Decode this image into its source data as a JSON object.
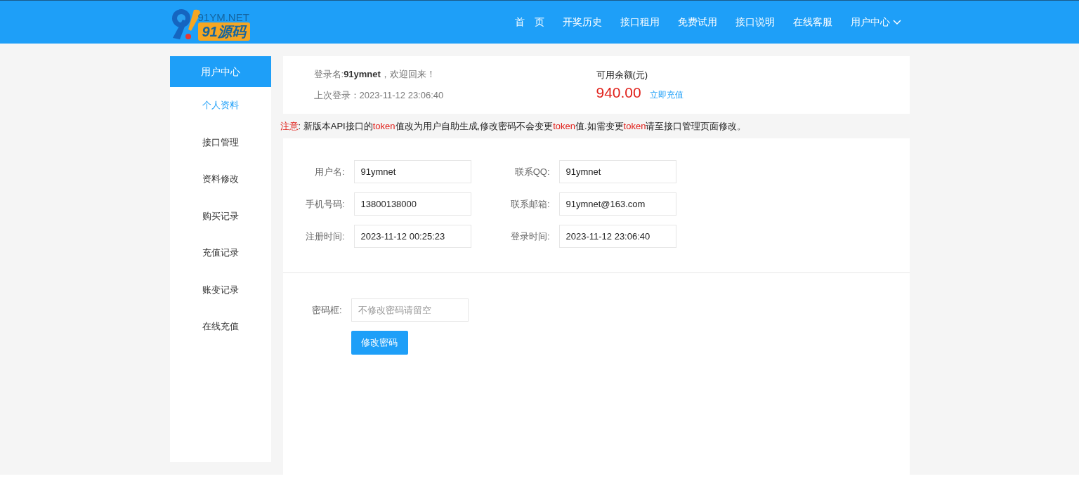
{
  "logo": {
    "domain": "91YM.NET",
    "name": "91源码"
  },
  "nav": [
    {
      "label": "首　页",
      "dropdown": false
    },
    {
      "label": "开奖历史",
      "dropdown": false
    },
    {
      "label": "接口租用",
      "dropdown": false
    },
    {
      "label": "免费试用",
      "dropdown": false
    },
    {
      "label": "接口说明",
      "dropdown": false
    },
    {
      "label": "在线客服",
      "dropdown": false
    },
    {
      "label": "用户中心",
      "dropdown": true
    }
  ],
  "sidebar": {
    "title": "用户中心",
    "items": [
      {
        "label": "个人资料",
        "selected": true
      },
      {
        "label": "接口管理",
        "selected": false
      },
      {
        "label": "资料修改",
        "selected": false
      },
      {
        "label": "购买记录",
        "selected": false
      },
      {
        "label": "充值记录",
        "selected": false
      },
      {
        "label": "账变记录",
        "selected": false
      },
      {
        "label": "在线充值",
        "selected": false
      }
    ]
  },
  "account": {
    "welcome": "登录名:**91ymnet**，欢迎回来！",
    "last_login": "上次登录：2023-11-12 23:06:40",
    "balance_label": "可用余额(元)",
    "balance": "940.00",
    "recharge_link": "立即充值"
  },
  "notice": [
    {
      "text": "注意",
      "red": true
    },
    {
      "text": ": 新版本API接口的",
      "red": false
    },
    {
      "text": "token",
      "red": true
    },
    {
      "text": "值改为用户自助生成,修改密码不会变更",
      "red": false
    },
    {
      "text": "token",
      "red": true
    },
    {
      "text": "值.如需变更",
      "red": false
    },
    {
      "text": "token",
      "red": true
    },
    {
      "text": "请至接口管理页面修改。",
      "red": false
    }
  ],
  "profile_fields": [
    {
      "label": "用户名:",
      "value": "91ymnet"
    },
    {
      "label": "联系QQ:",
      "value": "91ymnet"
    },
    {
      "label": "手机号码:",
      "value": "13800138000"
    },
    {
      "label": "联系邮箱:",
      "value": "91ymnet@163.com"
    },
    {
      "label": "注册时间:",
      "value": "2023-11-12 00:25:23"
    },
    {
      "label": "登录时间:",
      "value": "2023-11-12 23:06:40"
    }
  ],
  "password": {
    "label": "密码框:",
    "placeholder": "不修改密码请留空",
    "button": "修改密码"
  }
}
